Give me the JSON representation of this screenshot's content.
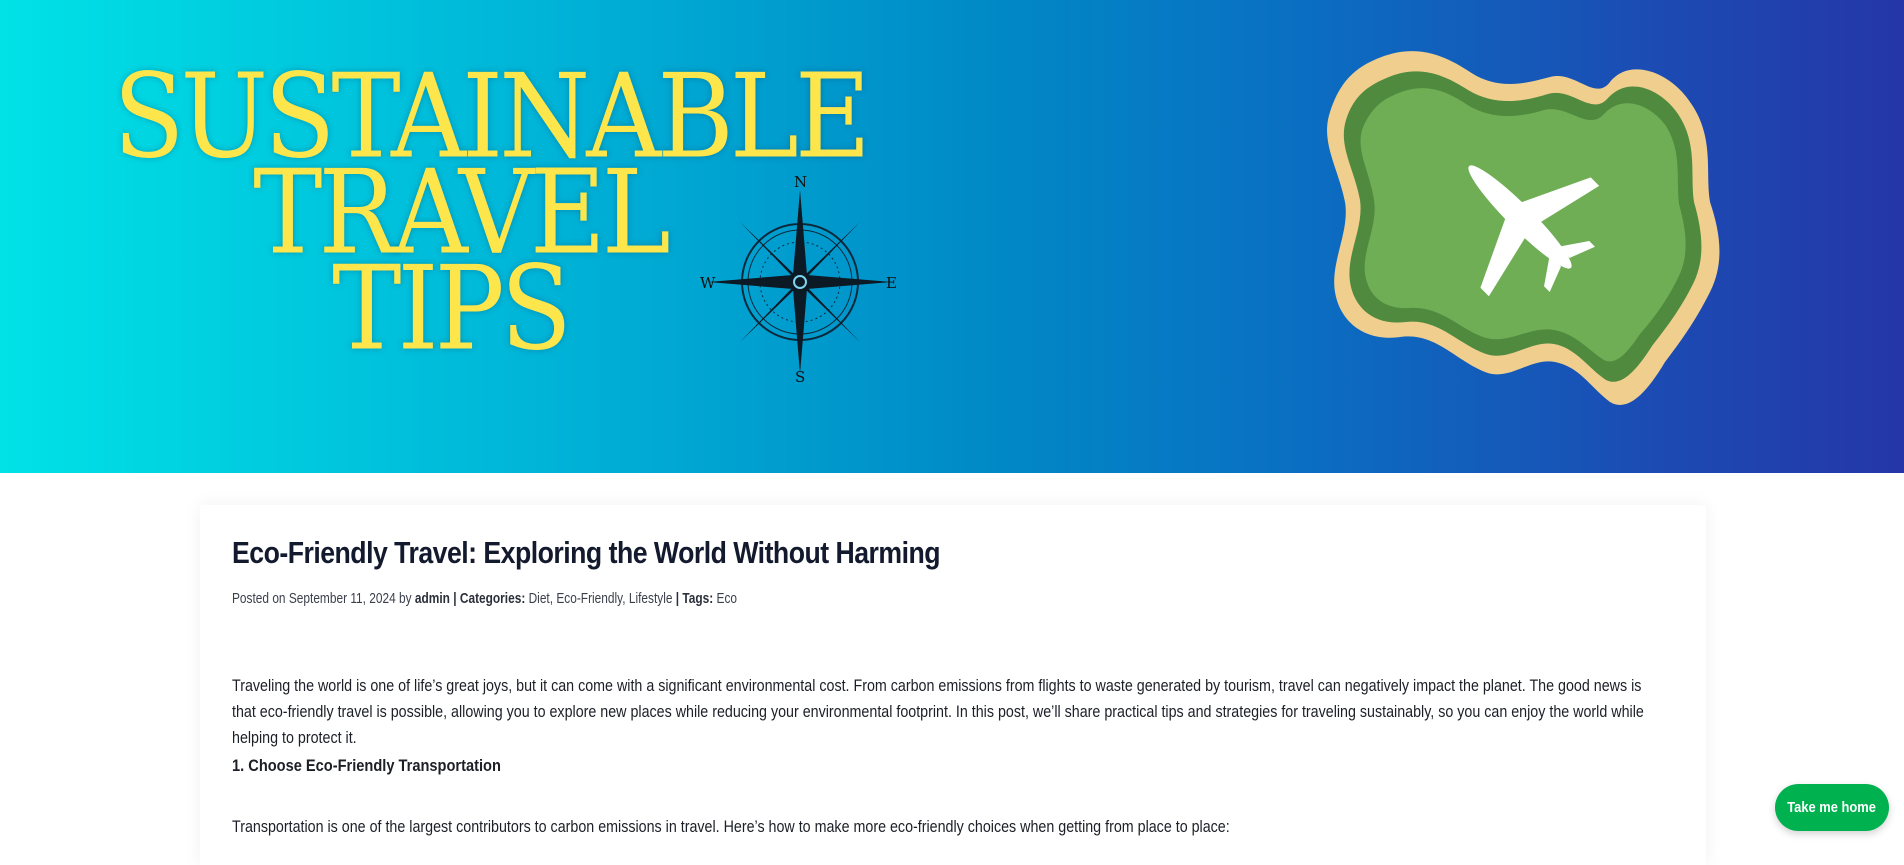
{
  "hero": {
    "line1": "SUSTAINABLE",
    "line2": "TRAVEL",
    "line3": "TIPS",
    "compass": {
      "n": "N",
      "e": "E",
      "s": "S",
      "w": "W"
    },
    "title_color": "#fde64b",
    "island_icon": "island-airplane-icon"
  },
  "post": {
    "title": "Eco-Friendly Travel: Exploring the World Without Harming",
    "meta": {
      "posted_prefix": "Posted on",
      "date": "September 11, 2024",
      "by": "by",
      "author": "admin",
      "sep": "|",
      "categories_label": "Categories:",
      "categories": [
        "Diet",
        "Eco-Friendly",
        "Lifestyle"
      ],
      "tags_label": "Tags:",
      "tags": [
        "Eco"
      ]
    },
    "intro": "Traveling the world is one of life’s great joys, but it can come with a significant environmental cost. From carbon emissions from flights to waste generated by tourism, travel can negatively impact the planet. The good news is that eco-friendly travel is possible, allowing you to explore new places while reducing your environmental footprint. In this post, we’ll share practical tips and strategies for traveling sustainably, so you can enjoy the world while helping to protect it.",
    "section1_heading": "1. Choose Eco-Friendly Transportation",
    "section1_text": "Transportation is one of the largest contributors to carbon emissions in travel. Here’s how to make more eco-friendly choices when getting from place to place:"
  },
  "floating_button": {
    "label": "Take me home",
    "color": "#00b14f"
  }
}
